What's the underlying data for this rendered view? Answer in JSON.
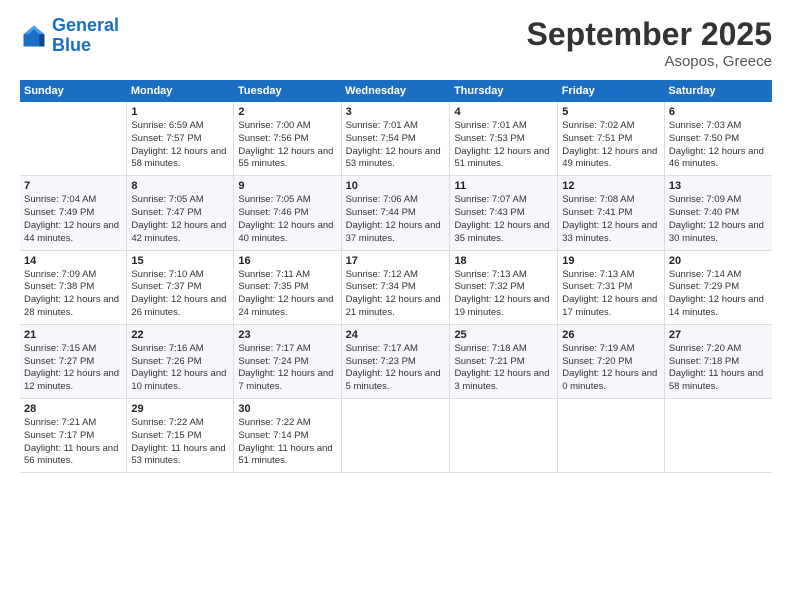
{
  "header": {
    "logo_line1": "General",
    "logo_line2": "Blue",
    "title": "September 2025",
    "subtitle": "Asopos, Greece"
  },
  "calendar": {
    "headers": [
      "Sunday",
      "Monday",
      "Tuesday",
      "Wednesday",
      "Thursday",
      "Friday",
      "Saturday"
    ],
    "rows": [
      [
        {
          "day": "",
          "info": ""
        },
        {
          "day": "1",
          "info": "Sunrise: 6:59 AM\nSunset: 7:57 PM\nDaylight: 12 hours and 58 minutes."
        },
        {
          "day": "2",
          "info": "Sunrise: 7:00 AM\nSunset: 7:56 PM\nDaylight: 12 hours and 55 minutes."
        },
        {
          "day": "3",
          "info": "Sunrise: 7:01 AM\nSunset: 7:54 PM\nDaylight: 12 hours and 53 minutes."
        },
        {
          "day": "4",
          "info": "Sunrise: 7:01 AM\nSunset: 7:53 PM\nDaylight: 12 hours and 51 minutes."
        },
        {
          "day": "5",
          "info": "Sunrise: 7:02 AM\nSunset: 7:51 PM\nDaylight: 12 hours and 49 minutes."
        },
        {
          "day": "6",
          "info": "Sunrise: 7:03 AM\nSunset: 7:50 PM\nDaylight: 12 hours and 46 minutes."
        }
      ],
      [
        {
          "day": "7",
          "info": "Sunrise: 7:04 AM\nSunset: 7:49 PM\nDaylight: 12 hours and 44 minutes."
        },
        {
          "day": "8",
          "info": "Sunrise: 7:05 AM\nSunset: 7:47 PM\nDaylight: 12 hours and 42 minutes."
        },
        {
          "day": "9",
          "info": "Sunrise: 7:05 AM\nSunset: 7:46 PM\nDaylight: 12 hours and 40 minutes."
        },
        {
          "day": "10",
          "info": "Sunrise: 7:06 AM\nSunset: 7:44 PM\nDaylight: 12 hours and 37 minutes."
        },
        {
          "day": "11",
          "info": "Sunrise: 7:07 AM\nSunset: 7:43 PM\nDaylight: 12 hours and 35 minutes."
        },
        {
          "day": "12",
          "info": "Sunrise: 7:08 AM\nSunset: 7:41 PM\nDaylight: 12 hours and 33 minutes."
        },
        {
          "day": "13",
          "info": "Sunrise: 7:09 AM\nSunset: 7:40 PM\nDaylight: 12 hours and 30 minutes."
        }
      ],
      [
        {
          "day": "14",
          "info": "Sunrise: 7:09 AM\nSunset: 7:38 PM\nDaylight: 12 hours and 28 minutes."
        },
        {
          "day": "15",
          "info": "Sunrise: 7:10 AM\nSunset: 7:37 PM\nDaylight: 12 hours and 26 minutes."
        },
        {
          "day": "16",
          "info": "Sunrise: 7:11 AM\nSunset: 7:35 PM\nDaylight: 12 hours and 24 minutes."
        },
        {
          "day": "17",
          "info": "Sunrise: 7:12 AM\nSunset: 7:34 PM\nDaylight: 12 hours and 21 minutes."
        },
        {
          "day": "18",
          "info": "Sunrise: 7:13 AM\nSunset: 7:32 PM\nDaylight: 12 hours and 19 minutes."
        },
        {
          "day": "19",
          "info": "Sunrise: 7:13 AM\nSunset: 7:31 PM\nDaylight: 12 hours and 17 minutes."
        },
        {
          "day": "20",
          "info": "Sunrise: 7:14 AM\nSunset: 7:29 PM\nDaylight: 12 hours and 14 minutes."
        }
      ],
      [
        {
          "day": "21",
          "info": "Sunrise: 7:15 AM\nSunset: 7:27 PM\nDaylight: 12 hours and 12 minutes."
        },
        {
          "day": "22",
          "info": "Sunrise: 7:16 AM\nSunset: 7:26 PM\nDaylight: 12 hours and 10 minutes."
        },
        {
          "day": "23",
          "info": "Sunrise: 7:17 AM\nSunset: 7:24 PM\nDaylight: 12 hours and 7 minutes."
        },
        {
          "day": "24",
          "info": "Sunrise: 7:17 AM\nSunset: 7:23 PM\nDaylight: 12 hours and 5 minutes."
        },
        {
          "day": "25",
          "info": "Sunrise: 7:18 AM\nSunset: 7:21 PM\nDaylight: 12 hours and 3 minutes."
        },
        {
          "day": "26",
          "info": "Sunrise: 7:19 AM\nSunset: 7:20 PM\nDaylight: 12 hours and 0 minutes."
        },
        {
          "day": "27",
          "info": "Sunrise: 7:20 AM\nSunset: 7:18 PM\nDaylight: 11 hours and 58 minutes."
        }
      ],
      [
        {
          "day": "28",
          "info": "Sunrise: 7:21 AM\nSunset: 7:17 PM\nDaylight: 11 hours and 56 minutes."
        },
        {
          "day": "29",
          "info": "Sunrise: 7:22 AM\nSunset: 7:15 PM\nDaylight: 11 hours and 53 minutes."
        },
        {
          "day": "30",
          "info": "Sunrise: 7:22 AM\nSunset: 7:14 PM\nDaylight: 11 hours and 51 minutes."
        },
        {
          "day": "",
          "info": ""
        },
        {
          "day": "",
          "info": ""
        },
        {
          "day": "",
          "info": ""
        },
        {
          "day": "",
          "info": ""
        }
      ]
    ]
  }
}
